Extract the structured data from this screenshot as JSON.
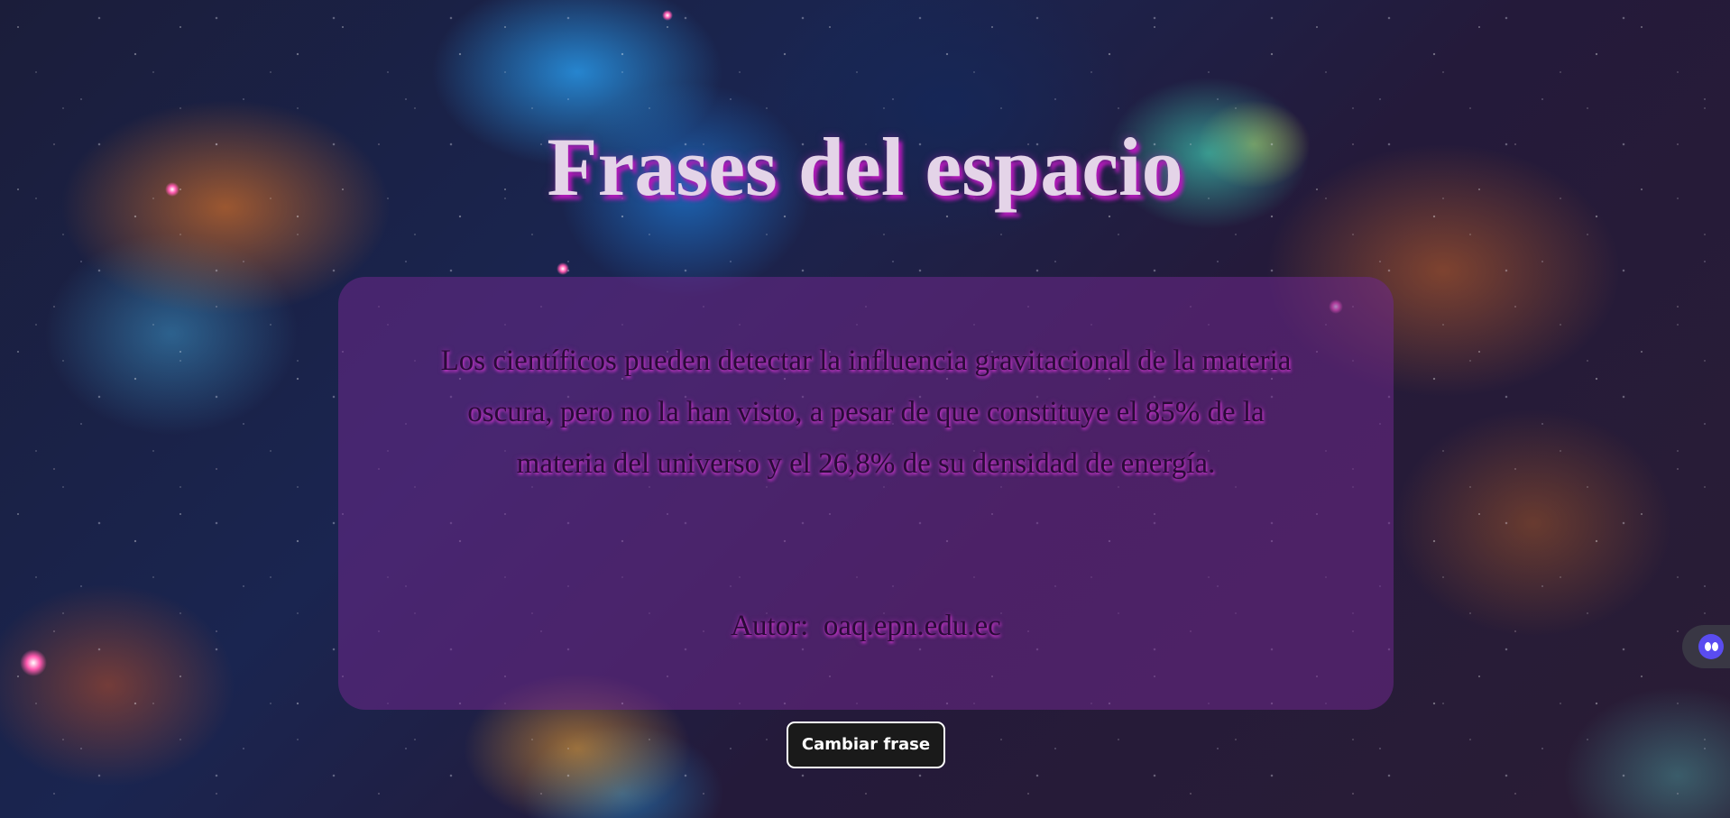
{
  "page": {
    "title": "Frases del espacio"
  },
  "quote_card": {
    "quote": "Los científicos pueden detectar la influencia gravitacional de la materia oscura, pero no la han visto, a pesar de que constituye el 85% de la materia del universo y el 26,8% de su densidad de energía.",
    "author_line": "Autor:  oaq.epn.edu.ec"
  },
  "actions": {
    "change_label": "Cambiar frase"
  },
  "side_widget": {
    "icon": "bot-icon"
  },
  "colors": {
    "title_text": "#e4d4e8",
    "title_shadow": "#b01ab8",
    "card_background": "rgba(110, 40, 140, 0.55)",
    "quote_text": "#2a0a38",
    "quote_shadow": "#d438d4",
    "button_background": "#1a1a1a",
    "button_border": "#ffffff",
    "widget_accent": "#5a4cf0"
  }
}
